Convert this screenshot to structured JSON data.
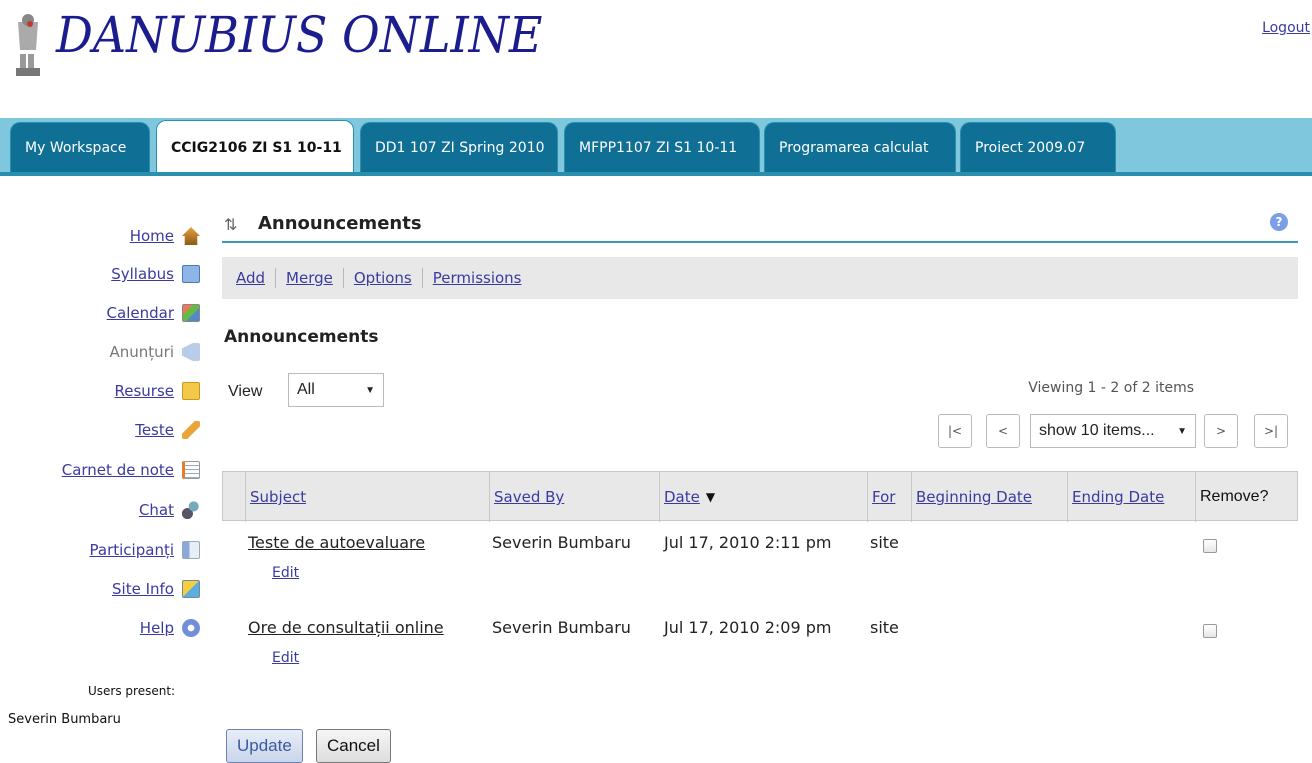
{
  "header": {
    "logo_text": "DANUBIUS ONLINE",
    "logout_label": "Logout"
  },
  "tabs": [
    {
      "label": "My Workspace",
      "active": false
    },
    {
      "label": "CCIG2106 ZI S1 10-11",
      "active": true
    },
    {
      "label": "DD1 107 ZI Spring 2010",
      "active": false
    },
    {
      "label": "MFPP1107 ZI S1 10-11",
      "active": false
    },
    {
      "label": "Programarea calculat",
      "active": false
    },
    {
      "label": "Proiect 2009.07",
      "active": false
    }
  ],
  "sidebar": {
    "items": [
      {
        "label": "Home",
        "icon": "home-icon",
        "link": true
      },
      {
        "label": "Syllabus",
        "icon": "syllabus-icon",
        "link": true
      },
      {
        "label": "Calendar",
        "icon": "calendar-icon",
        "link": true
      },
      {
        "label": "Anunțuri",
        "icon": "announcements-icon",
        "link": false
      },
      {
        "label": "Resurse",
        "icon": "folder-icon",
        "link": true
      },
      {
        "label": "Teste",
        "icon": "pencil-icon",
        "link": true
      },
      {
        "label": "Carnet de note",
        "icon": "gradebook-icon",
        "link": true
      },
      {
        "label": "Chat",
        "icon": "chat-icon",
        "link": true
      },
      {
        "label": "Participanți",
        "icon": "participants-icon",
        "link": true
      },
      {
        "label": "Site Info",
        "icon": "site-info-icon",
        "link": true
      },
      {
        "label": "Help",
        "icon": "help-icon",
        "link": true
      }
    ],
    "users_present_label": "Users present:",
    "users_present": [
      "Severin Bumbaru"
    ]
  },
  "main": {
    "title": "Announcements",
    "toolbar": [
      "Add",
      "Merge",
      "Options",
      "Permissions"
    ],
    "section_title": "Announcements",
    "view_label": "View",
    "view_value": "All",
    "viewing_text": "Viewing 1 - 2 of 2 items",
    "pager": {
      "first": "|<",
      "prev": "<",
      "page_size": "show 10 items...",
      "next": ">",
      "last": ">|"
    },
    "table": {
      "columns": [
        "Subject",
        "Saved By",
        "Date",
        "For",
        "Beginning Date",
        "Ending Date",
        "Remove?"
      ],
      "rows": [
        {
          "subject": "Teste de autoevaluare",
          "edit": "Edit",
          "saved_by": "Severin Bumbaru",
          "date": "Jul 17, 2010 2:11 pm",
          "for": "site",
          "beginning_date": "",
          "ending_date": ""
        },
        {
          "subject": "Ore de consultații online",
          "edit": "Edit",
          "saved_by": "Severin Bumbaru",
          "date": "Jul 17, 2010 2:09 pm",
          "for": "site",
          "beginning_date": "",
          "ending_date": ""
        }
      ]
    },
    "buttons": {
      "update": "Update",
      "cancel": "Cancel"
    }
  },
  "colors": {
    "tab_bar": "#7ec7dc",
    "tab": "#0f6f95",
    "link": "#3a3aa0",
    "logo": "#1b1c8e"
  }
}
